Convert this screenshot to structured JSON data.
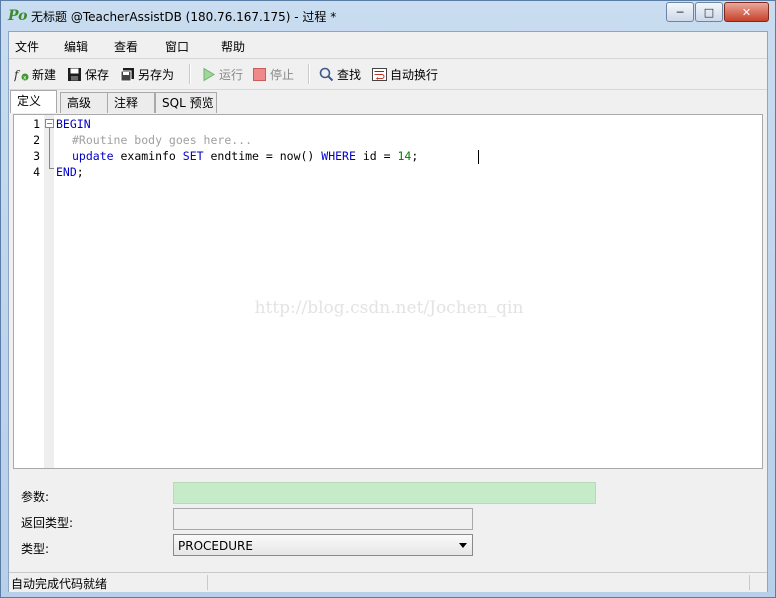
{
  "window": {
    "title": "无标题 @TeacherAssistDB (180.76.167.175) - 过程 *",
    "app_icon_text": "Po",
    "minimize_glyph": "─",
    "maximize_glyph": "□",
    "close_glyph": "✕"
  },
  "menu": [
    "文件",
    "编辑",
    "查看",
    "窗口",
    "帮助"
  ],
  "toolbar": {
    "new": "新建",
    "save": "保存",
    "save_as": "另存为",
    "run": "运行",
    "stop": "停止",
    "find": "查找",
    "word_wrap": "自动换行"
  },
  "tabs": [
    "定义",
    "高级",
    "注释",
    "SQL 预览"
  ],
  "editor": {
    "line_numbers": [
      "1",
      "2",
      "3",
      "4"
    ],
    "lines": {
      "l1_kw": "BEGIN",
      "l2_comment": "#Routine body goes here...",
      "l3_a": "update",
      "l3_b": " examinfo ",
      "l3_c": "SET",
      "l3_d": " endtime = now() ",
      "l3_e": "WHERE",
      "l3_f": " id = ",
      "l3_g": "14",
      "l3_h": ";",
      "l4_kw": "END",
      "l4_rest": ";"
    },
    "watermark": "http://blog.csdn.net/Jochen_qin"
  },
  "properties": {
    "params_label": "参数:",
    "params_value": "",
    "return_type_label": "返回类型:",
    "return_type_value": "",
    "type_label": "类型:",
    "type_value": "PROCEDURE"
  },
  "status": {
    "text": "自动完成代码就绪"
  },
  "colors": {
    "params_field_bg": "#c6ebc9",
    "keyword": "#0000c8",
    "comment": "#a0a0a0",
    "number": "#008000"
  }
}
